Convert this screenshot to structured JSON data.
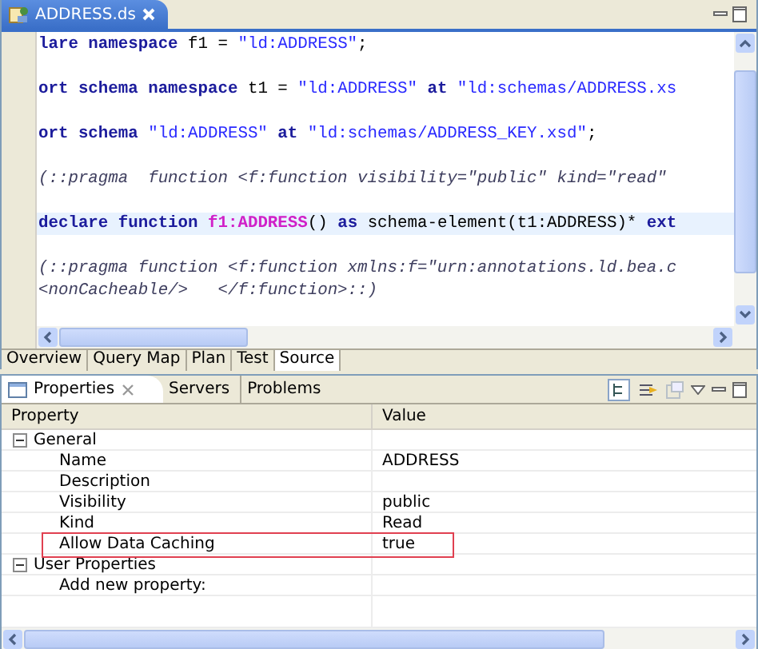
{
  "editor": {
    "tab": {
      "title": "ADDRESS.ds",
      "selected": true
    },
    "lines": [
      {
        "kind": "code",
        "highlighted": false,
        "segments": [
          {
            "text": "lare namespace",
            "kind": "keyword"
          },
          {
            "text": " f1 = ",
            "kind": "plain"
          },
          {
            "text": "\"ld:ADDRESS\"",
            "kind": "string"
          },
          {
            "text": ";",
            "kind": "plain"
          }
        ]
      },
      {
        "kind": "blank"
      },
      {
        "kind": "code",
        "highlighted": false,
        "segments": [
          {
            "text": "ort schema namespace",
            "kind": "keyword"
          },
          {
            "text": " t1 = ",
            "kind": "plain"
          },
          {
            "text": "\"ld:ADDRESS\"",
            "kind": "string"
          },
          {
            "text": " at ",
            "kind": "keyword"
          },
          {
            "text": "\"ld:schemas/ADDRESS.xs",
            "kind": "string"
          }
        ]
      },
      {
        "kind": "blank"
      },
      {
        "kind": "code",
        "highlighted": false,
        "segments": [
          {
            "text": "ort schema ",
            "kind": "keyword"
          },
          {
            "text": "\"ld:ADDRESS\"",
            "kind": "string"
          },
          {
            "text": " at ",
            "kind": "keyword"
          },
          {
            "text": "\"ld:schemas/ADDRESS_KEY.xsd\"",
            "kind": "string"
          },
          {
            "text": ";",
            "kind": "plain"
          }
        ]
      },
      {
        "kind": "blank"
      },
      {
        "kind": "code",
        "highlighted": false,
        "segments": [
          {
            "text": "(::pragma  function <f:function visibility=\"public\" kind=\"read\"",
            "kind": "comment"
          }
        ]
      },
      {
        "kind": "blank"
      },
      {
        "kind": "code",
        "highlighted": true,
        "segments": [
          {
            "text": "declare function ",
            "kind": "keyword"
          },
          {
            "text": "f1:ADDRESS",
            "kind": "function"
          },
          {
            "text": "() ",
            "kind": "plain"
          },
          {
            "text": "as",
            "kind": "keyword"
          },
          {
            "text": " schema-element(t1:ADDRESS)* ",
            "kind": "plain"
          },
          {
            "text": "ext",
            "kind": "keyword"
          }
        ]
      },
      {
        "kind": "blank"
      },
      {
        "kind": "code",
        "highlighted": false,
        "segments": [
          {
            "text": "(::pragma function <f:function xmlns:f=\"urn:annotations.ld.bea.c",
            "kind": "comment"
          }
        ]
      },
      {
        "kind": "code",
        "highlighted": false,
        "segments": [
          {
            "text": "<nonCacheable/>   </f:function>::)",
            "kind": "comment"
          }
        ]
      }
    ],
    "bottom_tabs": [
      {
        "label": "Overview",
        "selected": false
      },
      {
        "label": "Query Map",
        "selected": false
      },
      {
        "label": "Plan",
        "selected": false
      },
      {
        "label": "Test",
        "selected": false
      },
      {
        "label": "Source",
        "selected": true
      }
    ]
  },
  "properties_view": {
    "tabs": [
      {
        "label": "Properties",
        "selected": true,
        "closable": true
      },
      {
        "label": "Servers",
        "selected": false,
        "closable": false
      },
      {
        "label": "Problems",
        "selected": false,
        "closable": false
      }
    ],
    "columns": [
      "Property",
      "Value"
    ],
    "groups": [
      {
        "name": "General",
        "expanded": true,
        "rows": [
          {
            "property": "Name",
            "value": "ADDRESS",
            "outlined": false
          },
          {
            "property": "Description",
            "outlined": false
          },
          {
            "property": "Visibility",
            "value": "public",
            "outlined": false
          },
          {
            "property": "Kind",
            "value": "Read",
            "outlined": false
          },
          {
            "property": "Allow Data Caching",
            "value": "true",
            "outlined": true
          }
        ]
      },
      {
        "name": "User Properties",
        "expanded": true,
        "rows": [
          {
            "property": "Add new property:",
            "outlined": false
          }
        ]
      }
    ]
  }
}
